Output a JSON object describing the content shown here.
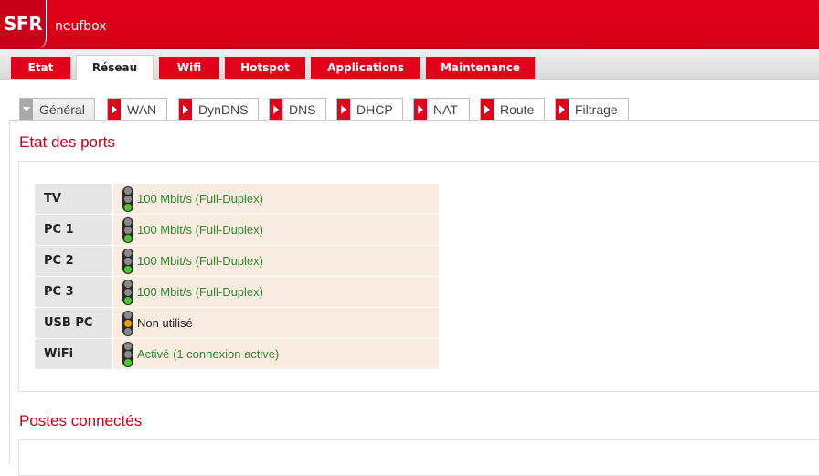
{
  "header": {
    "logo": "SFR",
    "product": "neufbox"
  },
  "main_tabs": [
    {
      "label": "Etat"
    },
    {
      "label": "Réseau"
    },
    {
      "label": "Wifi"
    },
    {
      "label": "Hotspot"
    },
    {
      "label": "Applications"
    },
    {
      "label": "Maintenance"
    }
  ],
  "main_tabs_active": "Réseau",
  "sub_tabs": [
    {
      "label": "Général"
    },
    {
      "label": "WAN"
    },
    {
      "label": "DynDNS"
    },
    {
      "label": "DNS"
    },
    {
      "label": "DHCP"
    },
    {
      "label": "NAT"
    },
    {
      "label": "Route"
    },
    {
      "label": "Filtrage"
    }
  ],
  "sub_tabs_active": "Général",
  "ports_section": {
    "title": "Etat des ports",
    "rows": [
      {
        "name": "TV",
        "status": "100 Mbit/s (Full-Duplex)",
        "light": "green"
      },
      {
        "name": "PC 1",
        "status": "100 Mbit/s (Full-Duplex)",
        "light": "green"
      },
      {
        "name": "PC 2",
        "status": "100 Mbit/s (Full-Duplex)",
        "light": "green"
      },
      {
        "name": "PC 3",
        "status": "100 Mbit/s (Full-Duplex)",
        "light": "green"
      },
      {
        "name": "USB PC",
        "status": "Non utilisé",
        "light": "orange"
      },
      {
        "name": "WiFi",
        "status": "Activé (1 connexion active)",
        "light": "green"
      }
    ]
  },
  "hosts_section": {
    "title": "Postes connectés"
  },
  "colors": {
    "brand_red": "#e2001a",
    "status_green": "#2e8a2e",
    "light_green": "#4cc82a",
    "light_orange": "#f0a000",
    "value_cell_bg": "#f8ece0"
  }
}
